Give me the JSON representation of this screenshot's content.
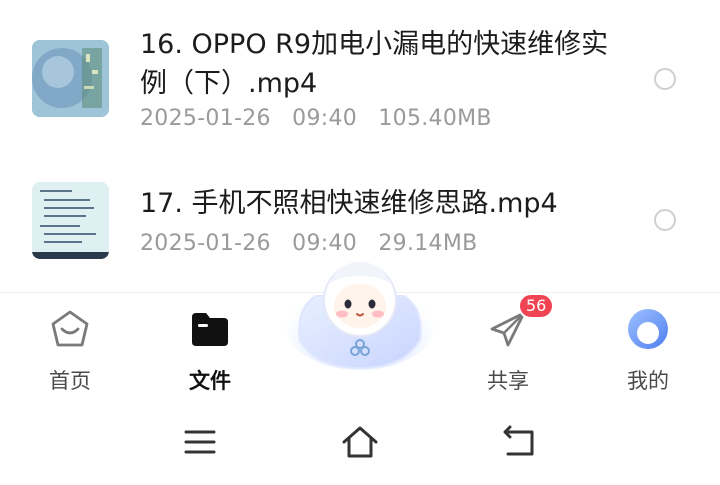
{
  "files": [
    {
      "title": "16. OPPO R9加电小漏电的快速维修实例（下）.mp4",
      "date": "2025-01-26",
      "time": "09:40",
      "size": "105.40MB",
      "thumbnail": "circuit-board-photo"
    },
    {
      "title": "17. 手机不照相快速维修思路.mp4",
      "date": "2025-01-26",
      "time": "09:40",
      "size": "29.14MB",
      "thumbnail": "handwritten-notes-photo"
    }
  ],
  "tabbar": {
    "home_label": "首页",
    "files_label": "文件",
    "share_label": "共享",
    "share_badge": "56",
    "mine_label": "我的",
    "active_tab": "文件"
  },
  "navbar": {
    "icons": [
      "menu-icon",
      "home-outline-icon",
      "back-icon"
    ]
  },
  "colors": {
    "badge": "#f04452",
    "meta_text": "#9a9a9a",
    "avatar_blue": "#5a8cff"
  }
}
